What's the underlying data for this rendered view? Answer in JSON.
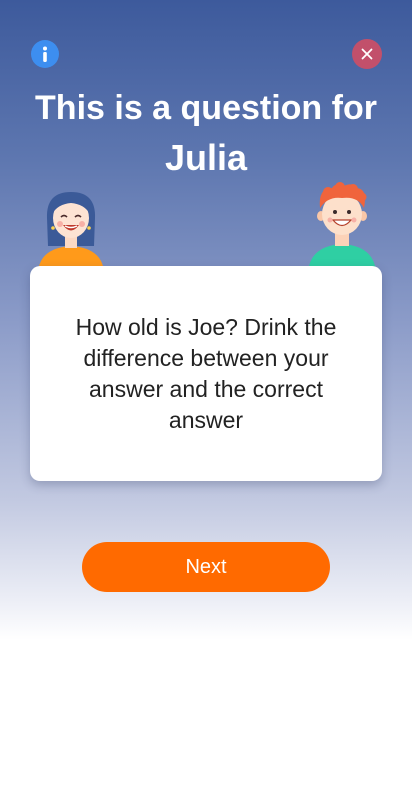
{
  "header": {
    "info_icon": "info-icon",
    "close_icon": "close-icon"
  },
  "title": {
    "line1": "This is a question for",
    "player_name": "Julia"
  },
  "avatars": {
    "left": "girl-avatar",
    "right": "boy-avatar"
  },
  "card": {
    "question": "How old is Joe? Drink the difference between your answer and the correct answer"
  },
  "actions": {
    "next_label": "Next"
  },
  "colors": {
    "accent": "#ff6a00",
    "info": "#3d8ef0",
    "close": "#c2506b",
    "background_top": "#3d5a9c"
  }
}
